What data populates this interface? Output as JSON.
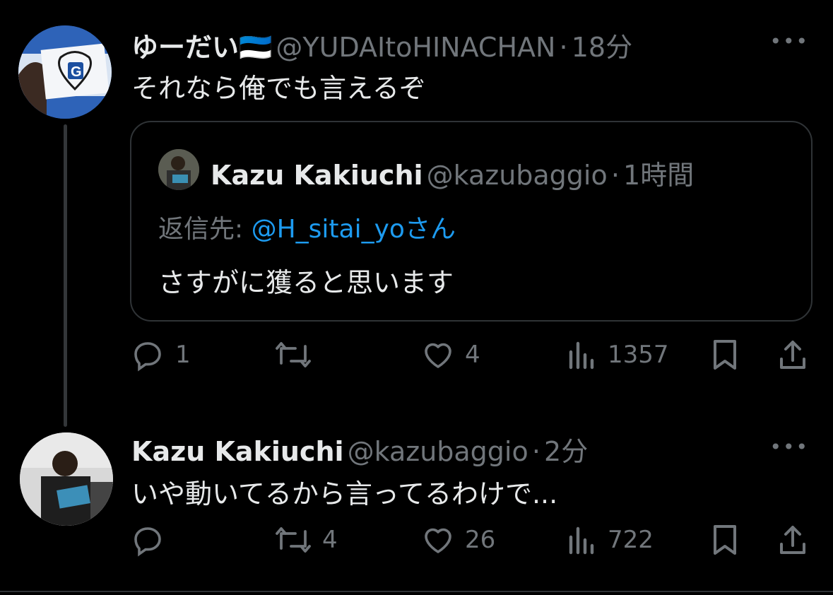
{
  "tweet1": {
    "name": "ゆーだい🇪🇪",
    "handle": "@YUDAItoHINACHAN",
    "time": "18分",
    "text": "それなら俺でも言えるぞ",
    "quote": {
      "name": "Kazu Kakiuchi",
      "handle": "@kazubaggio",
      "time": "1時間",
      "reply_prefix": "返信先:",
      "reply_mention": "@H_sitai_yo",
      "reply_suffix": "さん",
      "text": "さすがに獲ると思います"
    },
    "actions": {
      "replies": "1",
      "retweets": "",
      "likes": "4",
      "views": "1357"
    }
  },
  "tweet2": {
    "name": "Kazu Kakiuchi",
    "handle": "@kazubaggio",
    "time": "2分",
    "text": "いや動いてるから言ってるわけで...",
    "actions": {
      "replies": "",
      "retweets": "4",
      "likes": "26",
      "views": "722"
    }
  },
  "more_label": "•••",
  "dot": "·",
  "colors": {
    "background": "#000000",
    "text": "#e7e9ea",
    "muted": "#71767b",
    "link": "#1d9bf0",
    "border": "#2f3336"
  }
}
